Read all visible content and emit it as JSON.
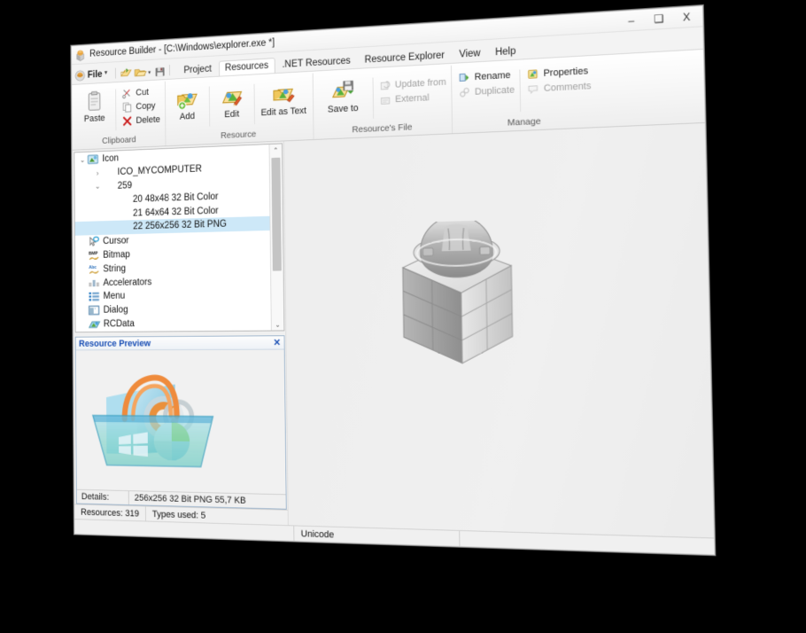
{
  "window": {
    "app_icon": "resource-builder-logo-icon",
    "title": "Resource Builder - [C:\\Windows\\explorer.exe *]",
    "controls": {
      "minimize": "–",
      "maximize": "❑",
      "close": "X"
    }
  },
  "quick_access": {
    "file_button": "File",
    "file_caret": "▾",
    "items": [
      {
        "name": "new-project-icon",
        "label": "New"
      },
      {
        "name": "open-project-icon",
        "label": "Open"
      },
      {
        "name": "open-dropdown-caret",
        "label": "▾"
      },
      {
        "name": "save-project-icon",
        "label": "Save"
      }
    ]
  },
  "tabs": [
    {
      "label": "Project",
      "active": false
    },
    {
      "label": "Resources",
      "active": true
    },
    {
      "label": ".NET Resources",
      "active": false
    },
    {
      "label": "Resource Explorer",
      "active": false
    },
    {
      "label": "View",
      "active": false
    },
    {
      "label": "Help",
      "active": false
    }
  ],
  "ribbon": {
    "groups": [
      {
        "name": "clipboard",
        "label": "Clipboard",
        "big": [
          {
            "name": "paste-button",
            "label": "Paste",
            "icon": "clipboard-icon",
            "enabled": true
          }
        ],
        "small": [
          {
            "name": "cut-button",
            "label": "Cut",
            "icon": "scissors-icon",
            "enabled": true
          },
          {
            "name": "copy-button",
            "label": "Copy",
            "icon": "copy-pages-icon",
            "enabled": true
          },
          {
            "name": "delete-button",
            "label": "Delete",
            "icon": "red-x-icon",
            "enabled": true
          }
        ]
      },
      {
        "name": "resource",
        "label": "Resource",
        "big": [
          {
            "name": "add-button",
            "label": "Add",
            "icon": "add-resource-icon",
            "enabled": true
          },
          {
            "name": "edit-button",
            "label": "Edit",
            "icon": "edit-resource-icon",
            "enabled": true
          },
          {
            "name": "edit-as-text-button",
            "label": "Edit as Text",
            "icon": "edit-text-resource-icon",
            "enabled": true
          }
        ],
        "small": []
      },
      {
        "name": "resources-file",
        "label": "Resource's File",
        "big": [
          {
            "name": "save-to-button",
            "label": "Save to",
            "icon": "save-to-icon",
            "enabled": true
          }
        ],
        "small": [
          {
            "name": "update-from-button",
            "label": "Update from",
            "icon": "update-from-icon",
            "enabled": false
          },
          {
            "name": "external-button",
            "label": "External",
            "icon": "external-file-icon",
            "enabled": false
          }
        ]
      },
      {
        "name": "manage",
        "label": "Manage",
        "big": [],
        "small": [
          {
            "name": "rename-button",
            "label": "Rename",
            "icon": "rename-icon",
            "enabled": true
          },
          {
            "name": "duplicate-button",
            "label": "Duplicate",
            "icon": "duplicate-icon",
            "enabled": false
          },
          {
            "name": "properties-button",
            "label": "Properties",
            "icon": "properties-icon",
            "enabled": true
          },
          {
            "name": "comments-button",
            "label": "Comments",
            "icon": "comments-icon",
            "enabled": false
          }
        ]
      }
    ]
  },
  "tree": {
    "rows": [
      {
        "label": "Icon",
        "indent": 0,
        "twisty": "expanded",
        "icon": "icon-folder-icon",
        "selected": false
      },
      {
        "label": "ICO_MYCOMPUTER",
        "indent": 1,
        "twisty": "collapsed",
        "icon": "none",
        "selected": false
      },
      {
        "label": "259",
        "indent": 1,
        "twisty": "expanded",
        "icon": "none",
        "selected": false
      },
      {
        "label": "20 48x48 32 Bit Color",
        "indent": 2,
        "twisty": "none",
        "icon": "none",
        "selected": false
      },
      {
        "label": "21 64x64 32 Bit Color",
        "indent": 2,
        "twisty": "none",
        "icon": "none",
        "selected": false
      },
      {
        "label": "22 256x256 32 Bit PNG",
        "indent": 2,
        "twisty": "none",
        "icon": "none",
        "selected": true
      },
      {
        "label": "Cursor",
        "indent": 0,
        "twisty": "none",
        "icon": "cursor-icon",
        "selected": false
      },
      {
        "label": "Bitmap",
        "indent": 0,
        "twisty": "none",
        "icon": "bitmap-icon",
        "selected": false
      },
      {
        "label": "String",
        "indent": 0,
        "twisty": "none",
        "icon": "string-abc-icon",
        "selected": false
      },
      {
        "label": "Accelerators",
        "indent": 0,
        "twisty": "none",
        "icon": "accelerators-icon",
        "selected": false
      },
      {
        "label": "Menu",
        "indent": 0,
        "twisty": "none",
        "icon": "menu-list-icon",
        "selected": false
      },
      {
        "label": "Dialog",
        "indent": 0,
        "twisty": "none",
        "icon": "dialog-window-icon",
        "selected": false
      },
      {
        "label": "RCData",
        "indent": 0,
        "twisty": "none",
        "icon": "rcdata-icon",
        "selected": false
      }
    ],
    "scrollbar": {
      "up_arrow": "⌃",
      "down_arrow": "⌄"
    }
  },
  "preview": {
    "title": "Resource Preview",
    "close": "✕",
    "image": "windows-store-bag-icon",
    "details_label": "Details:",
    "details_value": "256x256 32 Bit PNG 55,7 KB"
  },
  "statusbar": {
    "resources": "Resources: 319",
    "types_used": "Types used: 5",
    "encoding": "Unicode"
  },
  "canvas": {
    "watermark": "hardhat-brick-cube-icon"
  },
  "colors": {
    "accent": "#1a4fb5",
    "selection": "#cde8f8",
    "window_bg": "#f0f0f0",
    "desktop": "#000000"
  }
}
